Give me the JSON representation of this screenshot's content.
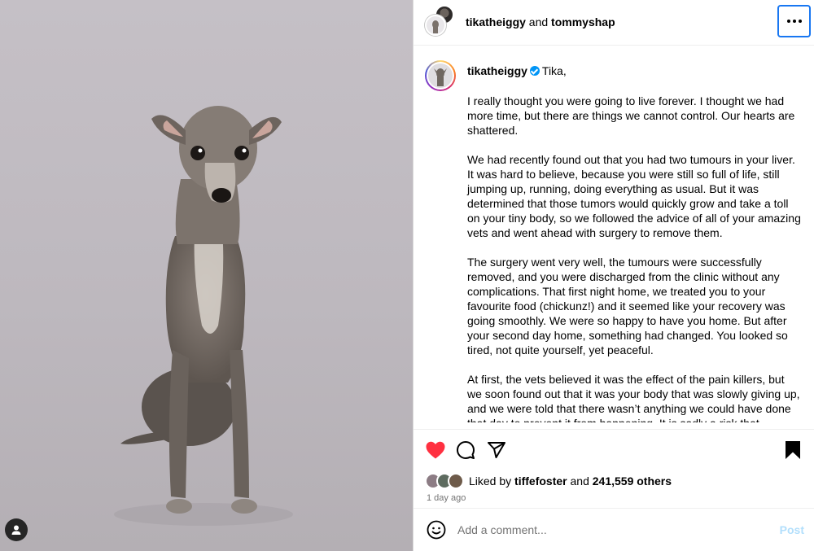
{
  "header": {
    "author1": "tikatheiggy",
    "joiner": "and",
    "author2": "tommyshap",
    "more_icon": "ellipsis-icon"
  },
  "caption": {
    "username": "tikatheiggy",
    "verified_icon": "verified-badge-icon",
    "greeting": "Tika,",
    "paragraphs": [
      "I really thought you were going to live forever. I thought we had more time, but there are things we cannot control. Our hearts are shattered.",
      "We had recently found out that you had two tumours in your liver. It was hard to believe, because you were still so full of life, still jumping up, running, doing everything as usual. But it was determined that those tumors would quickly grow and take a toll on your tiny body, so we followed the advice of all of your amazing vets and went ahead with surgery to remove them.",
      "The surgery went very well, the tumours were successfully removed, and you were discharged from the clinic without any complications. That first night home, we treated you to your favourite food (chickunz!) and it seemed like your recovery was going smoothly. We were so happy to have you home. But after your second day home, something had changed. You looked so tired, not quite yourself, yet peaceful.",
      "At first, the vets believed it was the effect of the pain killers, but we soon found out that it was your body that was slowly giving up, and we were told that there wasn’t anything we could have done that day to prevent it from happening. It is sadly a risk that"
    ]
  },
  "actions": {
    "like_icon": "heart-filled-icon",
    "comment_icon": "comment-icon",
    "share_icon": "share-icon",
    "save_icon": "bookmark-filled-icon",
    "like_color": "#ff3040"
  },
  "likes": {
    "prefix": "Liked by",
    "user": "tiffefoster",
    "conjunction": "and",
    "count": "241,559 others"
  },
  "timestamp": "1 day ago",
  "comment": {
    "placeholder": "Add a comment...",
    "post_label": "Post",
    "emoji_icon": "emoji-icon"
  },
  "photo": {
    "subject": "dog-photo",
    "tag_icon": "user-tag-icon"
  }
}
